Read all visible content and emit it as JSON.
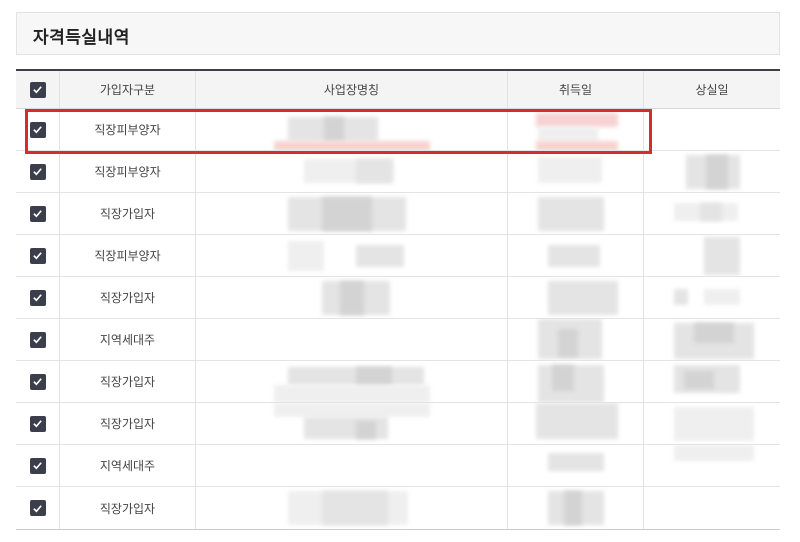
{
  "section": {
    "title": "자격득실내역"
  },
  "table": {
    "headers": {
      "type": "가입자구분",
      "workplace": "사업장명칭",
      "acquired": "취득일",
      "lost": "상실일"
    },
    "rows": [
      {
        "type": "직장피부양자",
        "checked": true
      },
      {
        "type": "직장피부양자",
        "checked": true
      },
      {
        "type": "직장가입자",
        "checked": true
      },
      {
        "type": "직장피부양자",
        "checked": true
      },
      {
        "type": "직장가입자",
        "checked": true
      },
      {
        "type": "지역세대주",
        "checked": true
      },
      {
        "type": "직장가입자",
        "checked": true
      },
      {
        "type": "직장가입자",
        "checked": true
      },
      {
        "type": "지역세대주",
        "checked": true
      },
      {
        "type": "직장가입자",
        "checked": true
      }
    ]
  },
  "colors": {
    "header_border": "#3a3f4b",
    "checkbox": "#3b3f4c",
    "highlight": "#d52c2c"
  }
}
